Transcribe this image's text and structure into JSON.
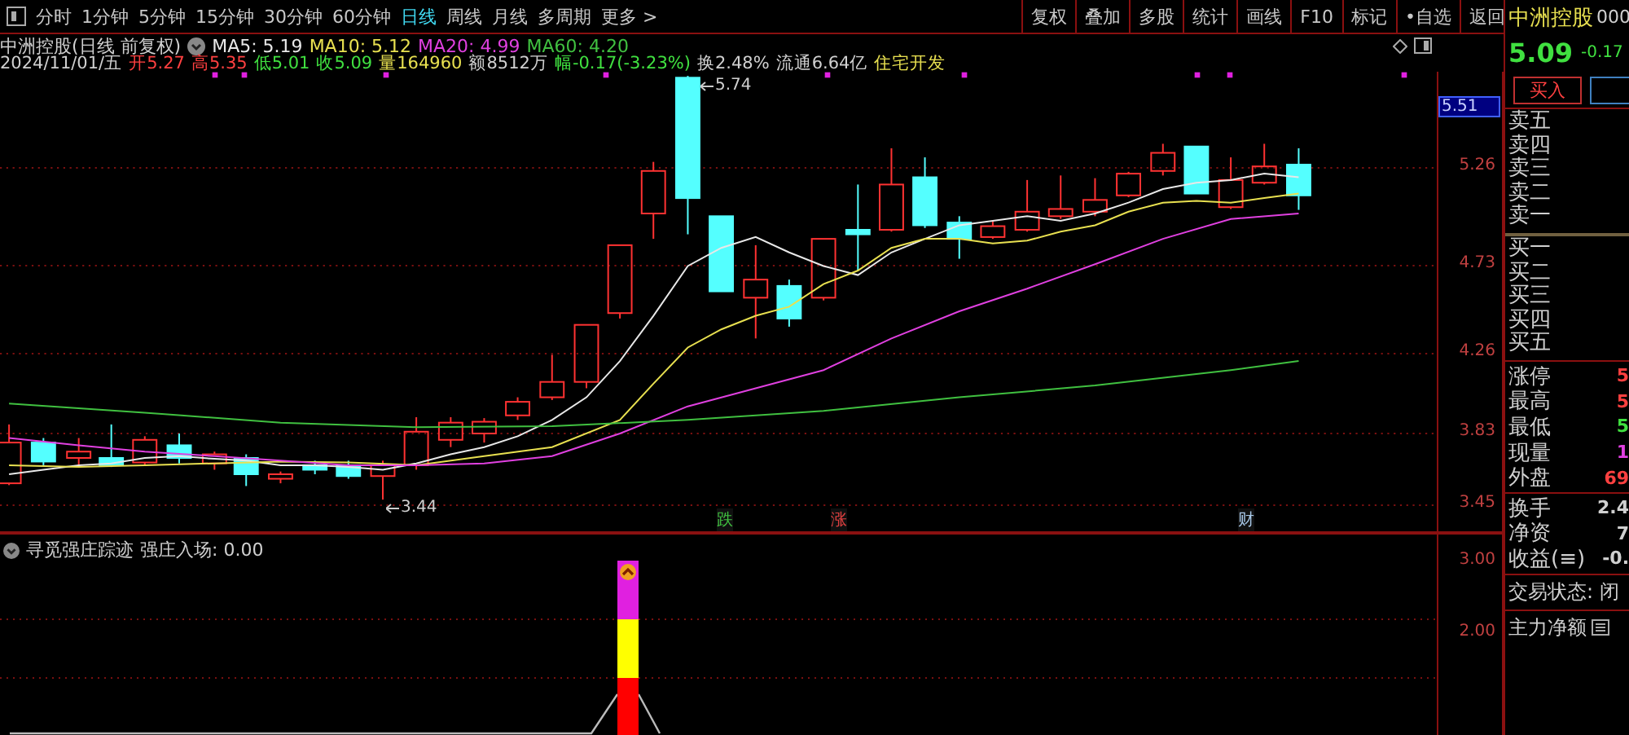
{
  "toolbar": {
    "tabs": [
      {
        "label": "分时",
        "selected": false
      },
      {
        "label": "1分钟",
        "selected": false
      },
      {
        "label": "5分钟",
        "selected": false
      },
      {
        "label": "15分钟",
        "selected": false
      },
      {
        "label": "30分钟",
        "selected": false
      },
      {
        "label": "60分钟",
        "selected": false
      },
      {
        "label": "日线",
        "selected": true
      },
      {
        "label": "周线",
        "selected": false
      },
      {
        "label": "月线",
        "selected": false
      },
      {
        "label": "多周期",
        "selected": false
      },
      {
        "label": "更多 >",
        "selected": false
      }
    ],
    "buttons": [
      "复权",
      "叠加",
      "多股",
      "统计",
      "画线",
      "F10",
      "标记",
      "•自选",
      "返回"
    ]
  },
  "chart_header": {
    "title": "中洲控股(日线 前复权)",
    "moving_averages": [
      {
        "label": "MA5: 5.19",
        "color": "#e8e8e8"
      },
      {
        "label": "MA10: 5.12",
        "color": "#e8e050"
      },
      {
        "label": "MA20: 4.99",
        "color": "#e040e0"
      },
      {
        "label": "MA60: 4.20",
        "color": "#40c040"
      }
    ]
  },
  "quote_line": [
    {
      "text": "2024/11/01/五",
      "color": "#d0d0d0"
    },
    {
      "text": "开5.27",
      "color": "#ff4040"
    },
    {
      "text": "高5.35",
      "color": "#ff4040"
    },
    {
      "text": "低5.01",
      "color": "#40e040"
    },
    {
      "text": "收5.09",
      "color": "#40e040"
    },
    {
      "text": "量164960",
      "color": "#e8e050"
    },
    {
      "text": "额8512万",
      "color": "#d0d0d0"
    },
    {
      "text": "幅-0.17(-3.23%)",
      "color": "#40e040"
    },
    {
      "text": "换2.48%",
      "color": "#d0d0d0"
    },
    {
      "text": "流通6.64亿",
      "color": "#d0d0d0"
    },
    {
      "text": "住宅开发",
      "color": "#e8e050"
    }
  ],
  "chart": {
    "y_labels": [
      "5.26",
      "4.73",
      "4.26",
      "3.83",
      "3.45"
    ],
    "cursor_price": "5.51",
    "high_marker": "5.74",
    "low_marker": "3.44",
    "event_tags": [
      {
        "text": "跌",
        "color": "#40c040"
      },
      {
        "text": "涨",
        "color": "#e04040"
      },
      {
        "text": "财",
        "color": "#a8c8e8"
      }
    ]
  },
  "indicator": {
    "title": "寻觅强庄踪迹",
    "reading": "强庄入场: 0.00",
    "y_labels": [
      "3.00",
      "2.00"
    ]
  },
  "side_panel": {
    "name": "中洲控股",
    "code": "000",
    "price": "5.09",
    "change": "-0.17",
    "buy_button": "买入",
    "asks": [
      "卖五",
      "卖四",
      "卖三",
      "卖二",
      "卖一"
    ],
    "bids": [
      "买一",
      "买二",
      "买三",
      "买四",
      "买五"
    ],
    "stats": [
      {
        "label": "涨停",
        "value": "5",
        "color": "#ff4040"
      },
      {
        "label": "最高",
        "value": "5",
        "color": "#ff4040"
      },
      {
        "label": "最低",
        "value": "5",
        "color": "#40e040"
      },
      {
        "label": "现量",
        "value": "1",
        "color": "#e040e0"
      },
      {
        "label": "外盘",
        "value": "69",
        "color": "#ff4040"
      }
    ],
    "finance": [
      {
        "label": "换手",
        "value": "2.4"
      },
      {
        "label": "净资",
        "value": "7"
      },
      {
        "label": "收益(≡)",
        "value": "-0."
      }
    ],
    "status": "交易状态: 闭",
    "main_net": "主力净额"
  }
}
